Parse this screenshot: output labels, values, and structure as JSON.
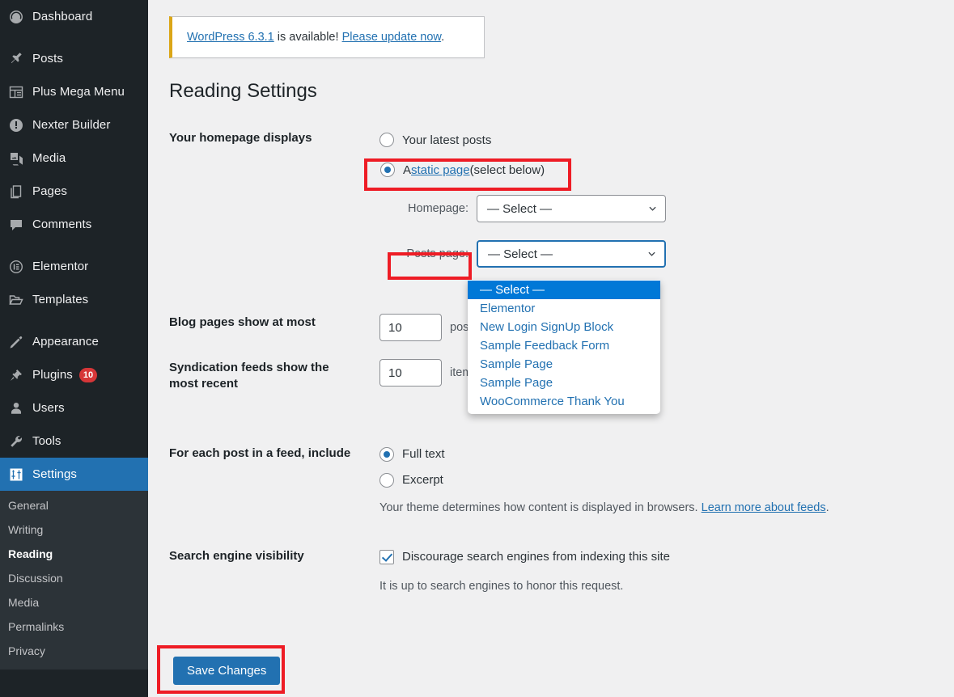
{
  "sidebar": {
    "items": [
      {
        "label": "Dashboard",
        "icon": "dashboard-icon",
        "current": false
      },
      {
        "label": "Posts",
        "icon": "pin-icon",
        "current": false
      },
      {
        "label": "Plus Mega Menu",
        "icon": "table-icon",
        "current": false
      },
      {
        "label": "Nexter Builder",
        "icon": "exclamation-circle-icon",
        "current": false
      },
      {
        "label": "Media",
        "icon": "media-icon",
        "current": false
      },
      {
        "label": "Pages",
        "icon": "pages-icon",
        "current": false
      },
      {
        "label": "Comments",
        "icon": "comment-icon",
        "current": false
      },
      {
        "label": "Elementor",
        "icon": "elementor-icon",
        "current": false
      },
      {
        "label": "Templates",
        "icon": "folder-icon",
        "current": false
      },
      {
        "label": "Appearance",
        "icon": "paintbrush-icon",
        "current": false
      },
      {
        "label": "Plugins",
        "icon": "plug-icon",
        "badge": "10",
        "current": false
      },
      {
        "label": "Users",
        "icon": "user-icon",
        "current": false
      },
      {
        "label": "Tools",
        "icon": "wrench-icon",
        "current": false
      },
      {
        "label": "Settings",
        "icon": "settings-icon",
        "current": true
      }
    ],
    "submenu": [
      {
        "label": "General",
        "current": false
      },
      {
        "label": "Writing",
        "current": false
      },
      {
        "label": "Reading",
        "current": true
      },
      {
        "label": "Discussion",
        "current": false
      },
      {
        "label": "Media",
        "current": false
      },
      {
        "label": "Permalinks",
        "current": false
      },
      {
        "label": "Privacy",
        "current": false
      }
    ]
  },
  "notice": {
    "version_link": "WordPress 6.3.1",
    "middle_text": " is available! ",
    "update_link": "Please update now",
    "period": "."
  },
  "page_title": "Reading Settings",
  "homepage_section": {
    "label": "Your homepage displays",
    "option_latest": "Your latest posts",
    "option_static_prefix": "A ",
    "option_static_link": "static page",
    "option_static_suffix": " (select below)",
    "homepage_label": "Homepage:",
    "homepage_value": "— Select —",
    "posts_page_label": "Posts page:",
    "posts_page_value": "— Select —",
    "dropdown_options": [
      {
        "label": "— Select —",
        "selected": true
      },
      {
        "label": "Elementor",
        "selected": false
      },
      {
        "label": "New Login SignUp Block",
        "selected": false
      },
      {
        "label": "Sample Feedback Form",
        "selected": false
      },
      {
        "label": "Sample Page",
        "selected": false
      },
      {
        "label": "Sample Page",
        "selected": false
      },
      {
        "label": "WooCommerce Thank You",
        "selected": false
      }
    ]
  },
  "blog_pages": {
    "label": "Blog pages show at most",
    "value": "10",
    "unit": "posts"
  },
  "syndication": {
    "label": "Syndication feeds show the most recent",
    "value": "10",
    "unit": "items"
  },
  "feed_section": {
    "label": "For each post in a feed, include",
    "option_full": "Full text",
    "option_excerpt": "Excerpt",
    "note_text": "Your theme determines how content is displayed in browsers. ",
    "note_link": "Learn more about feeds",
    "note_period": "."
  },
  "search_visibility": {
    "label": "Search engine visibility",
    "checkbox_label": "Discourage search engines from indexing this site",
    "note": "It is up to search engines to honor this request."
  },
  "save_button": "Save Changes",
  "colors": {
    "accent": "#2271b1",
    "sidebar_bg": "#1d2327",
    "highlight_red": "#ee1c25",
    "dropdown_selected": "#0078d7",
    "notice_border": "#dba617",
    "badge_red": "#d63638"
  }
}
